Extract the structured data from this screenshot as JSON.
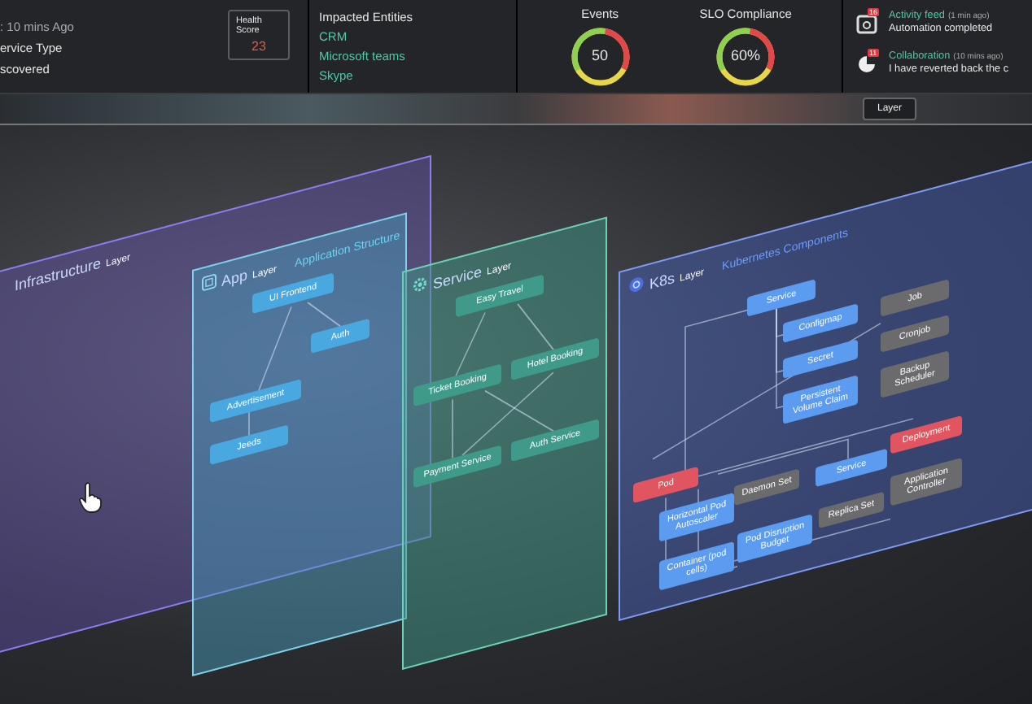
{
  "header": {
    "info": {
      "time": ": 10 mins Ago",
      "type_label": "ervice Type",
      "type_value": "scovered"
    },
    "health_score": {
      "label": "Health Score",
      "value": "23"
    },
    "impacted": {
      "title": "Impacted Entities",
      "entities": [
        "CRM",
        "Microsoft teams",
        "Skype"
      ]
    },
    "gauges": [
      {
        "title": "Events",
        "value": "50"
      },
      {
        "title": "SLO Compliance",
        "value": "60%"
      }
    ],
    "feed": [
      {
        "kind": "automation",
        "badge": "16",
        "title": "Activity feed",
        "time": "(1 min ago)",
        "text": "Automation completed"
      },
      {
        "kind": "collaboration",
        "badge": "11",
        "title": "Collaboration",
        "time": "(10 mins ago)",
        "text": "I have reverted back the c"
      }
    ]
  },
  "layer_button": "Layer",
  "layers": [
    {
      "kind": "infrastructure",
      "name": "Infrastructure",
      "tag": "Layer"
    },
    {
      "kind": "app",
      "name": "App",
      "tag": "Layer",
      "subtitle": "Application Structure",
      "nodes": [
        {
          "label": "UI Frontend",
          "color": "#4aa8e0"
        },
        {
          "label": "Auth",
          "color": "#4aa8e0"
        },
        {
          "label": "Advertisement",
          "color": "#4aa8e0"
        },
        {
          "label": "Jeeds",
          "color": "#4aa8e0"
        }
      ]
    },
    {
      "kind": "service",
      "name": "Service",
      "tag": "Layer",
      "nodes": [
        {
          "label": "Easy Travel",
          "color": "#3f9a8a"
        },
        {
          "label": "Ticket Booking",
          "color": "#3f9a8a"
        },
        {
          "label": "Hotel Booking",
          "color": "#3f9a8a"
        },
        {
          "label": "Payment Service",
          "color": "#3f9a8a"
        },
        {
          "label": "Auth Service",
          "color": "#3f9a8a"
        }
      ]
    },
    {
      "kind": "k8s",
      "name": "K8s",
      "tag": "Layer",
      "subtitle": "Kubernetes Components",
      "nodes": [
        {
          "label": "Service",
          "color": "#5b9cf0"
        },
        {
          "label": "Configmap",
          "color": "#5b9cf0"
        },
        {
          "label": "Secret",
          "color": "#5b9cf0"
        },
        {
          "label": "Persistent Volume Claim",
          "color": "#5b9cf0"
        },
        {
          "label": "Job",
          "color": "#6b6b6e"
        },
        {
          "label": "Cronjob",
          "color": "#6b6b6e"
        },
        {
          "label": "Backup Scheduler",
          "color": "#6b6b6e"
        },
        {
          "label": "Pod",
          "color": "#e05560"
        },
        {
          "label": "Horizontal Pod Autoscaler",
          "color": "#5b9cf0"
        },
        {
          "label": "Container (pod cells)",
          "color": "#5b9cf0"
        },
        {
          "label": "Daemon Set",
          "color": "#6b6b6e"
        },
        {
          "label": "Pod Disruption Budget",
          "color": "#5b9cf0"
        },
        {
          "label": "Service",
          "color": "#5b9cf0"
        },
        {
          "label": "Replica Set",
          "color": "#6b6b6e"
        },
        {
          "label": "Deployment",
          "color": "#e05560"
        },
        {
          "label": "Application Controller",
          "color": "#6b6b6e"
        }
      ]
    }
  ]
}
